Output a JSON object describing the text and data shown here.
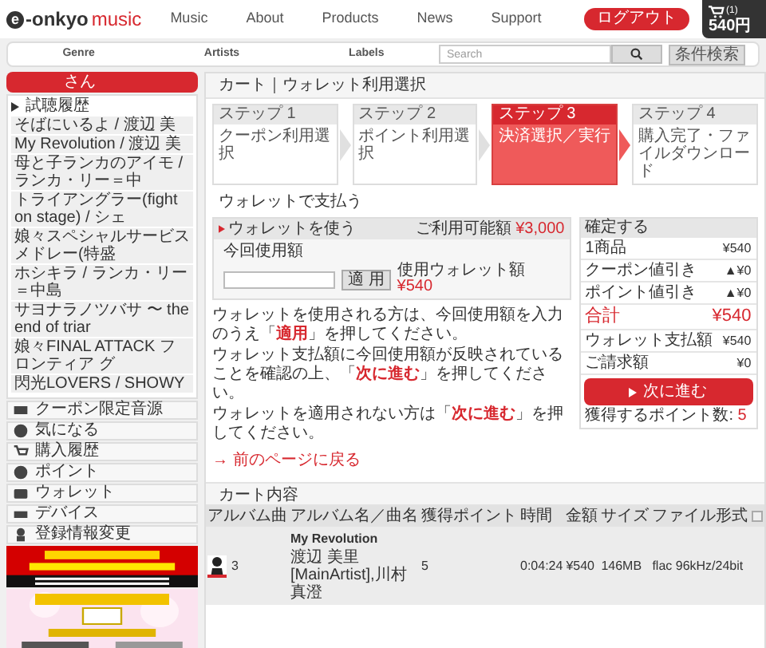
{
  "header": {
    "logo": {
      "mark": "e",
      "name": "-onkyo",
      "accent": "music"
    },
    "nav": [
      "Music",
      "About",
      "Products",
      "News",
      "Support"
    ],
    "logout": "ログアウト",
    "cart": {
      "count": "(1)",
      "total": "540円"
    }
  },
  "subnav": {
    "links": [
      "Genre",
      "Artists",
      "Labels"
    ],
    "search": {
      "placeholder": "Search"
    },
    "advanced": "条件検索"
  },
  "sidebar": {
    "user": "さん",
    "history_title": "試聴履歴",
    "history": [
      "そばにいるよ / 渡辺 美",
      "My Revolution / 渡辺 美",
      "母と子ランカのアイモ / ランカ・リー＝中",
      "トライアングラー(fight on stage) / シェ",
      "娘々スペシャルサービスメドレー(特盛",
      "ホシキラ / ランカ・リー＝中島",
      "サヨナラノツバサ 〜 the end of triar",
      "娘々FINAL ATTACK フロンティア グ",
      "閃光LOVERS / SHOWY"
    ],
    "menu": [
      "クーポン限定音源",
      "気になる",
      "購入履歴",
      "ポイント",
      "ウォレット",
      "デバイス",
      "登録情報変更"
    ]
  },
  "main": {
    "title": "カート｜ウォレット利用選択",
    "steps": [
      {
        "step": "ステップ 1",
        "label": "クーポン利用選択",
        "selected": false
      },
      {
        "step": "ステップ 2",
        "label": "ポイント利用選択",
        "selected": false
      },
      {
        "step": "ステップ 3",
        "label": "決済選択／実行",
        "selected": true
      },
      {
        "step": "ステップ 4",
        "label": "購入完了・ファイルダウンロード",
        "selected": false
      }
    ],
    "section_title": "ウォレットで支払う",
    "wallet": {
      "title": "ウォレットを使う",
      "available_label": "ご利用可能額",
      "available": "¥3,000",
      "amount_label": "今回使用額",
      "apply": "適 用",
      "used_label": "使用ウォレット額",
      "used": "¥540"
    },
    "instructions": [
      "ウォレットを使用される方は、今回使用額を入力のうえ「**適用**」を押してください。",
      "ウォレット支払額に今回使用額が反映されていることを確認の上、「**次に進む**」を押してください。",
      "ウォレットを適用されない方は「**次に進む**」を押してください。"
    ],
    "back_link": "→ 前のページに戻る",
    "summary": {
      "title": "確定する",
      "rows": [
        {
          "label": "1商品",
          "value": "¥540",
          "kind": "normal"
        },
        {
          "label": "クーポン値引き",
          "value": "▲¥0",
          "kind": "normal"
        },
        {
          "label": "ポイント値引き",
          "value": "▲¥0",
          "kind": "normal"
        },
        {
          "label": "合計",
          "value": "¥540",
          "kind": "total"
        },
        {
          "label": "ウォレット支払額",
          "value": "¥540",
          "kind": "normal"
        },
        {
          "label": "ご請求額",
          "value": "¥0",
          "kind": "normal"
        }
      ],
      "next": "次に進む",
      "points_label": "獲得するポイント数:",
      "points": "5"
    },
    "cart": {
      "title": "カート内容",
      "columns": [
        "アルバム曲",
        "アルバム名／曲名",
        "獲得ポイント",
        "時間",
        "金額",
        "サイズ",
        "ファイル形式"
      ],
      "rows": [
        {
          "track": "3",
          "title": "My Revolution",
          "artist": "渡辺 美里[MainArtist],川村真澄",
          "points": "5",
          "time": "0:04:24",
          "price": "¥540",
          "size": "146MB",
          "format": "flac 96kHz/24bit"
        }
      ]
    }
  }
}
